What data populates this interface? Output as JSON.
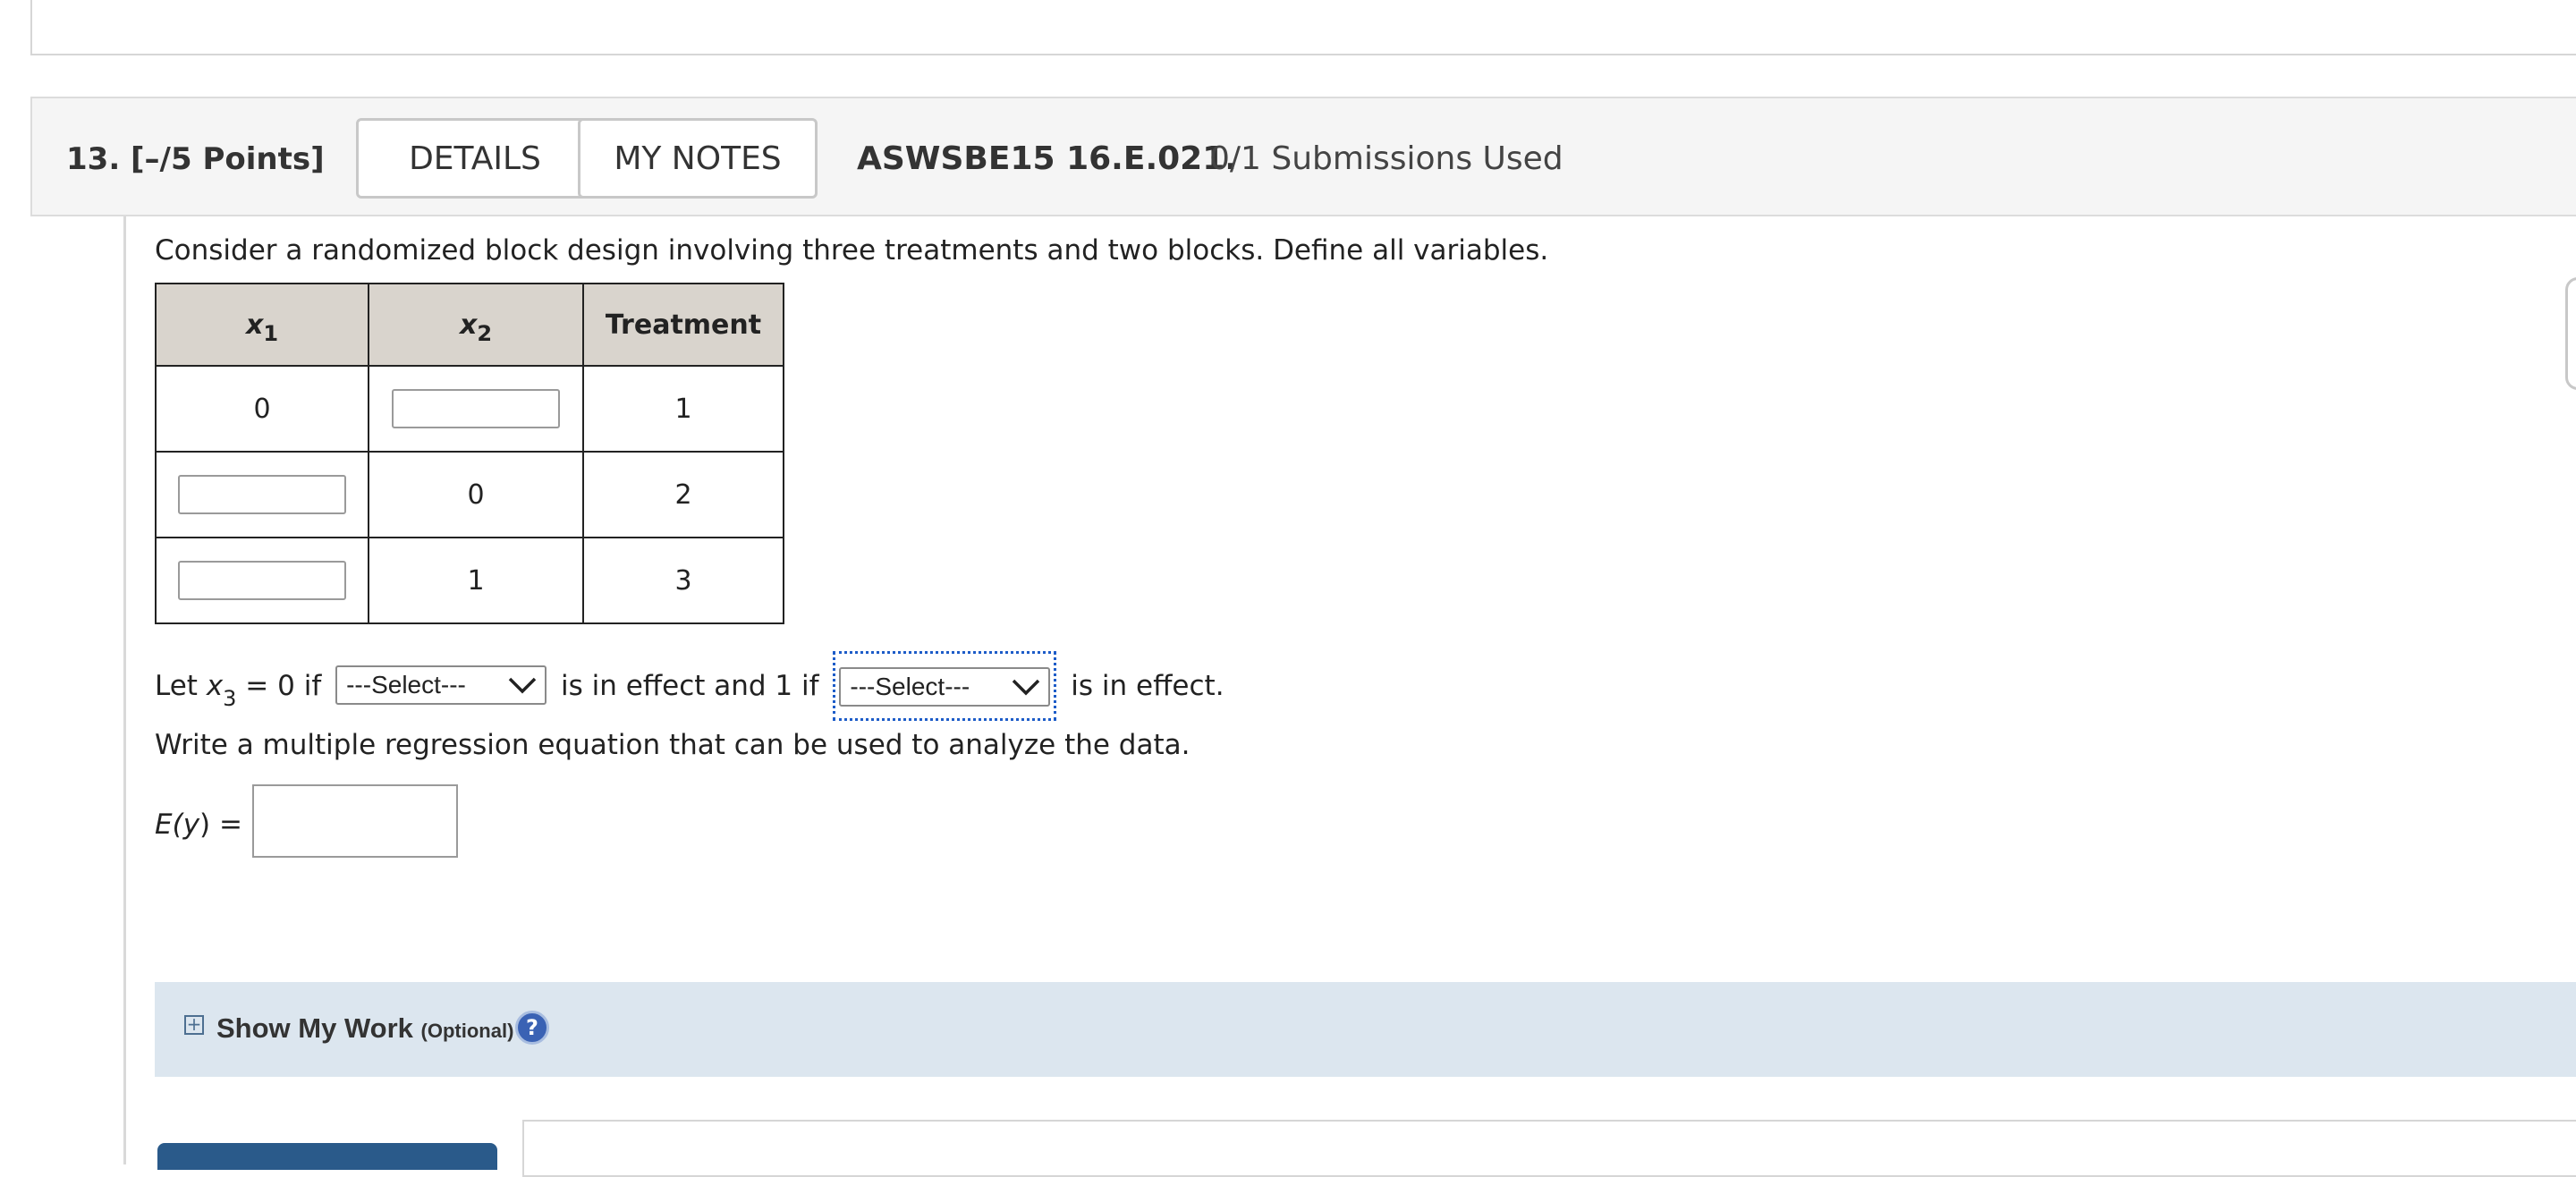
{
  "question": {
    "number": "13.",
    "points": "[–/5 Points]",
    "details_label": "DETAILS",
    "notes_label": "MY NOTES",
    "code": "ASWSBE15 16.E.021.",
    "submissions": "0/1 Submissions Used"
  },
  "prompt": "Consider a randomized block design involving three treatments and two blocks. Define all variables.",
  "table": {
    "headers": {
      "x1_var": "x",
      "x1_sub": "1",
      "x2_var": "x",
      "x2_sub": "2",
      "treatment": "Treatment"
    },
    "rows": [
      {
        "x1": "0",
        "x2": "",
        "treatment": "1"
      },
      {
        "x1": "",
        "x2": "0",
        "treatment": "2"
      },
      {
        "x1": "",
        "x2": "1",
        "treatment": "3"
      }
    ]
  },
  "x3_line": {
    "prefix": "Let ",
    "var": "x",
    "sub": "3",
    "eq_text": " = 0 if",
    "select1": "---Select---",
    "middle": "is in effect and 1 if",
    "select2": "---Select---",
    "suffix": "is in effect."
  },
  "regression_prompt": "Write a multiple regression equation that can be used to analyze the data.",
  "equation": {
    "lhs_func": "E(",
    "lhs_var": "y",
    "lhs_close": ") =",
    "value": ""
  },
  "show_work": {
    "plus": "+",
    "title": "Show My Work",
    "optional": "(Optional)",
    "help": "?"
  }
}
